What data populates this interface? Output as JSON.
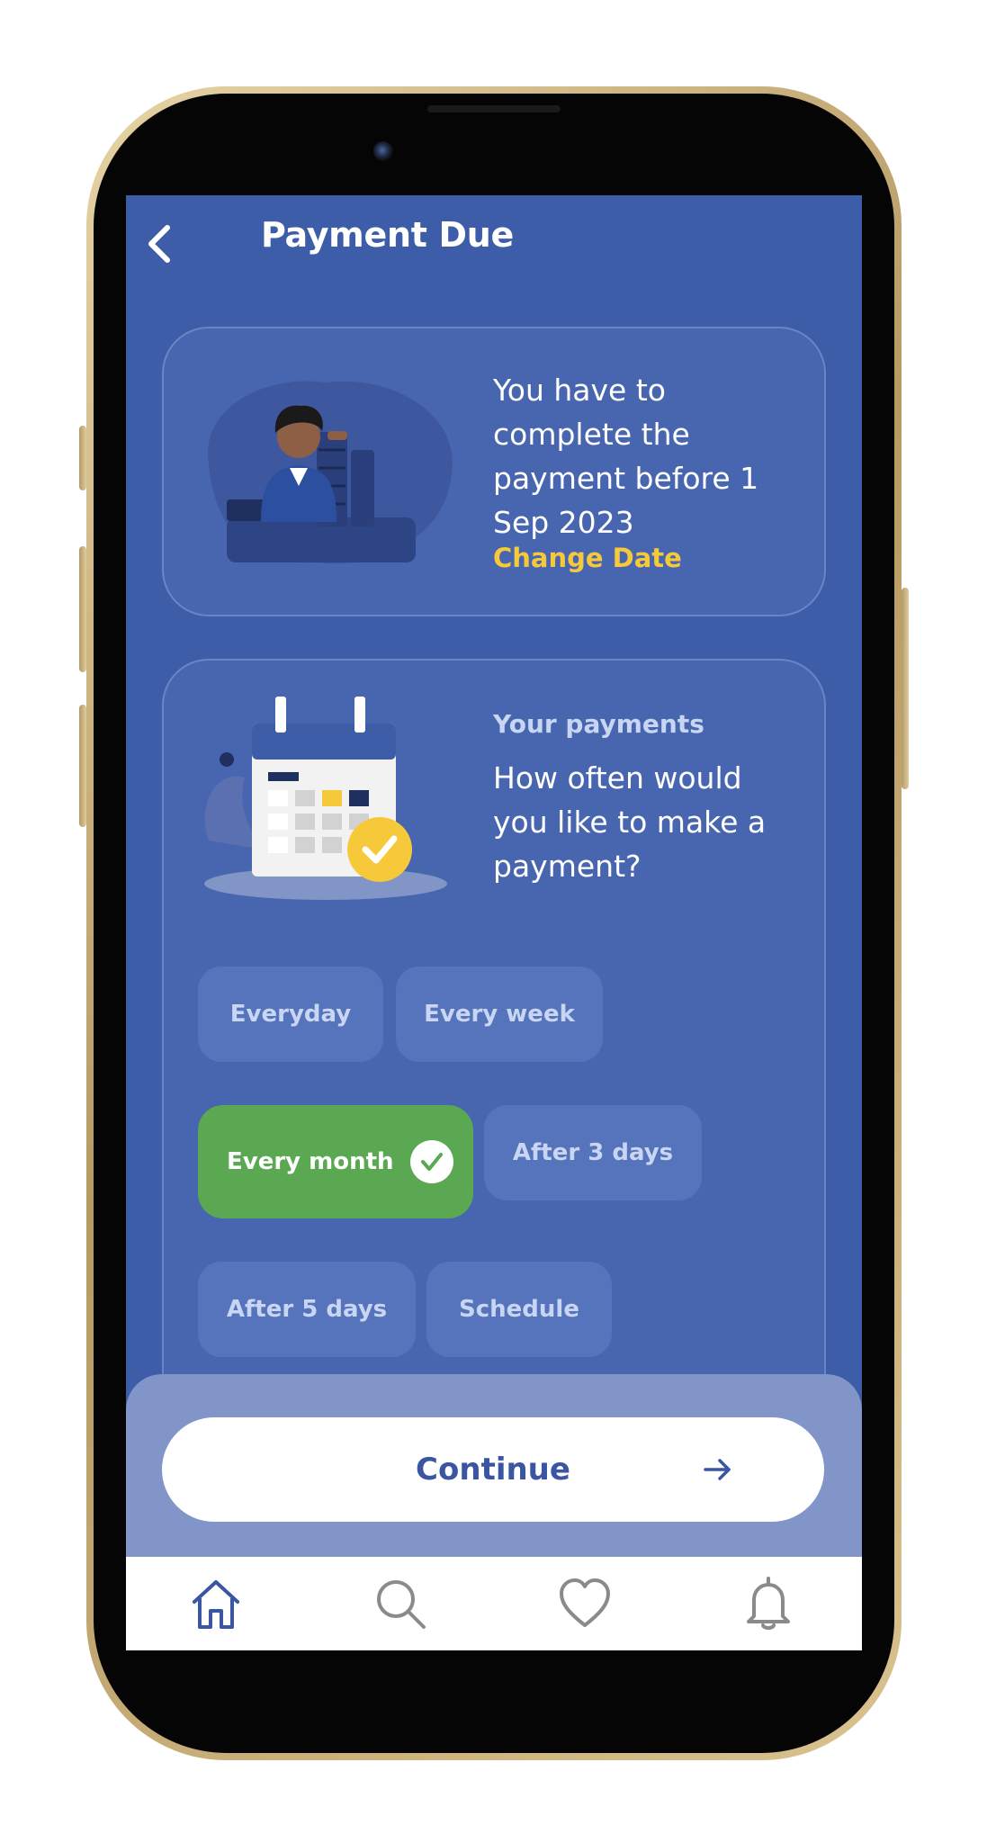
{
  "header": {
    "title": "Payment Due"
  },
  "info_card": {
    "message": "You have to complete the payment before 1 Sep 2023",
    "change_date_label": "Change Date"
  },
  "payments_card": {
    "subtitle": "Your payments",
    "question": "How often would you like to make a payment?",
    "options": [
      {
        "label": "Everyday",
        "selected": false
      },
      {
        "label": "Every week",
        "selected": false
      },
      {
        "label": "Every month",
        "selected": true
      },
      {
        "label": "After 3 days",
        "selected": false
      },
      {
        "label": "After 5 days",
        "selected": false
      },
      {
        "label": "Schedule",
        "selected": false
      }
    ]
  },
  "continue_button": {
    "label": "Continue",
    "icon": "arrow-right-icon"
  },
  "tabbar": {
    "items": [
      {
        "icon": "home-icon",
        "active": true
      },
      {
        "icon": "search-icon",
        "active": false
      },
      {
        "icon": "heart-icon",
        "active": false
      },
      {
        "icon": "bell-icon",
        "active": false
      }
    ]
  },
  "colors": {
    "screen_bg": "#3d5da8",
    "card_bg": "#4866b0",
    "accent_yellow": "#f6c93b",
    "selected_green": "#5aa852",
    "continue_text": "#3a56a3"
  }
}
